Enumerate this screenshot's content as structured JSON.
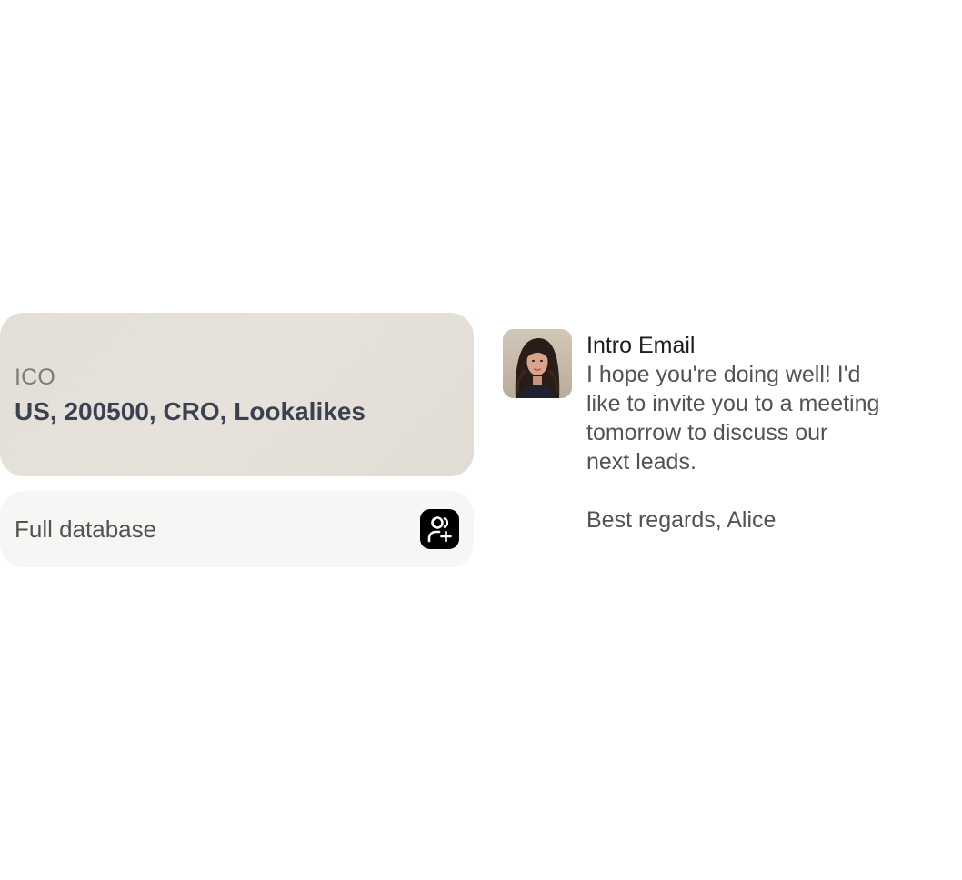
{
  "icp": {
    "label": "ICO",
    "value": "US, 200500, CRO, Lookalikes"
  },
  "database": {
    "label": "Full database",
    "action_icon": "user-add-icon"
  },
  "email": {
    "avatar_icon": "avatar",
    "title": "Intro Email",
    "body": "I hope you're doing well! I'd\nlike to invite you to a meeting\ntomorrow to discuss our\nnext leads.",
    "signoff": "Best regards, Alice"
  },
  "colors": {
    "icp_card_bg": "#e3dfd8",
    "db_card_bg": "#f7f6f4",
    "button_bg": "#000000",
    "value_text": "#3b4150"
  }
}
